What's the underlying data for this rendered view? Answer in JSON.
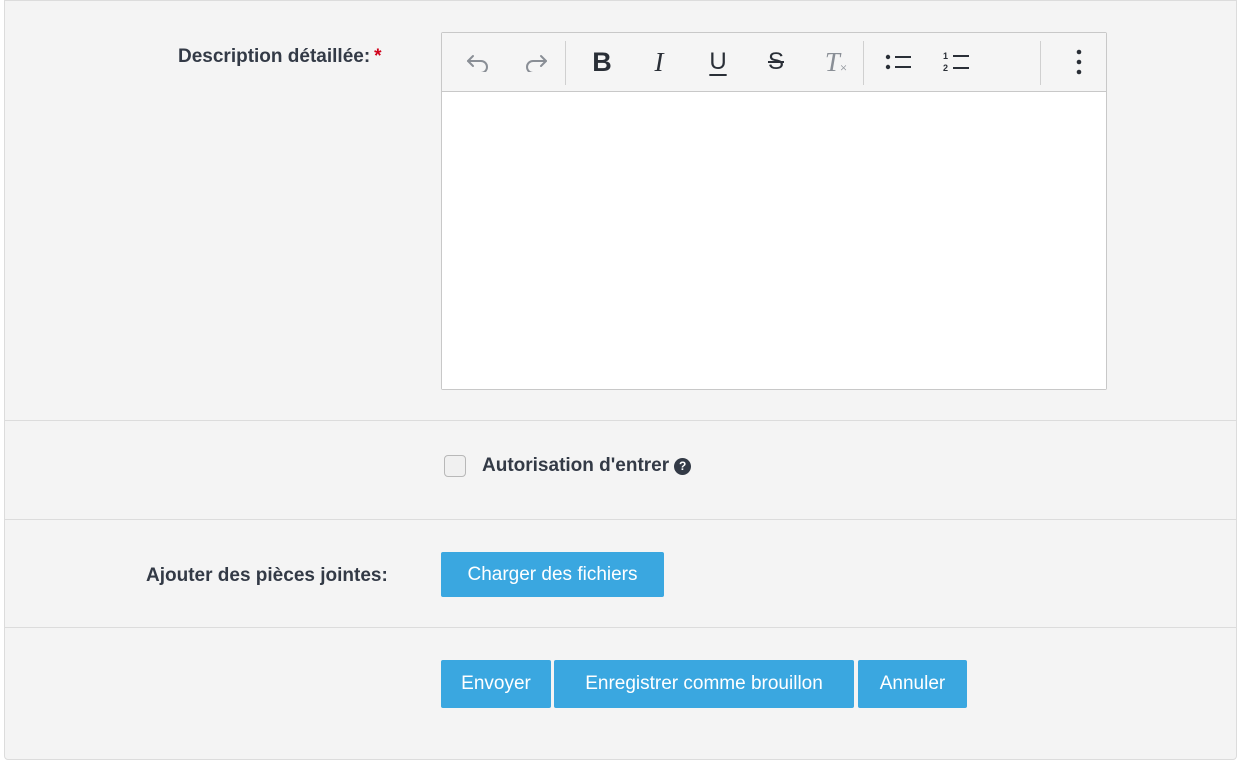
{
  "description": {
    "label": "Description détaillée:",
    "required_mark": "*"
  },
  "editor": {
    "toolbar": [
      "undo-icon",
      "redo-icon",
      "bold-icon",
      "italic-icon",
      "underline-icon",
      "strikethrough-icon",
      "clear-format-icon",
      "bullet-list-icon",
      "numbered-list-icon",
      "more-vertical-icon"
    ],
    "bold_glyph": "B",
    "italic_glyph": "I",
    "underline_glyph": "U",
    "strike_glyph": "S",
    "clear_glyph": "T"
  },
  "permission": {
    "label": "Autorisation d'entrer",
    "checked": false,
    "help_glyph": "?"
  },
  "attachments": {
    "label": "Ajouter des pièces jointes:",
    "upload_button": "Charger des fichiers"
  },
  "actions": {
    "send": "Envoyer",
    "save_draft": "Enregistrer comme brouillon",
    "cancel": "Annuler"
  },
  "colors": {
    "accent": "#3aa7e0",
    "required": "#d0021b",
    "panel_bg": "#f4f4f4"
  }
}
